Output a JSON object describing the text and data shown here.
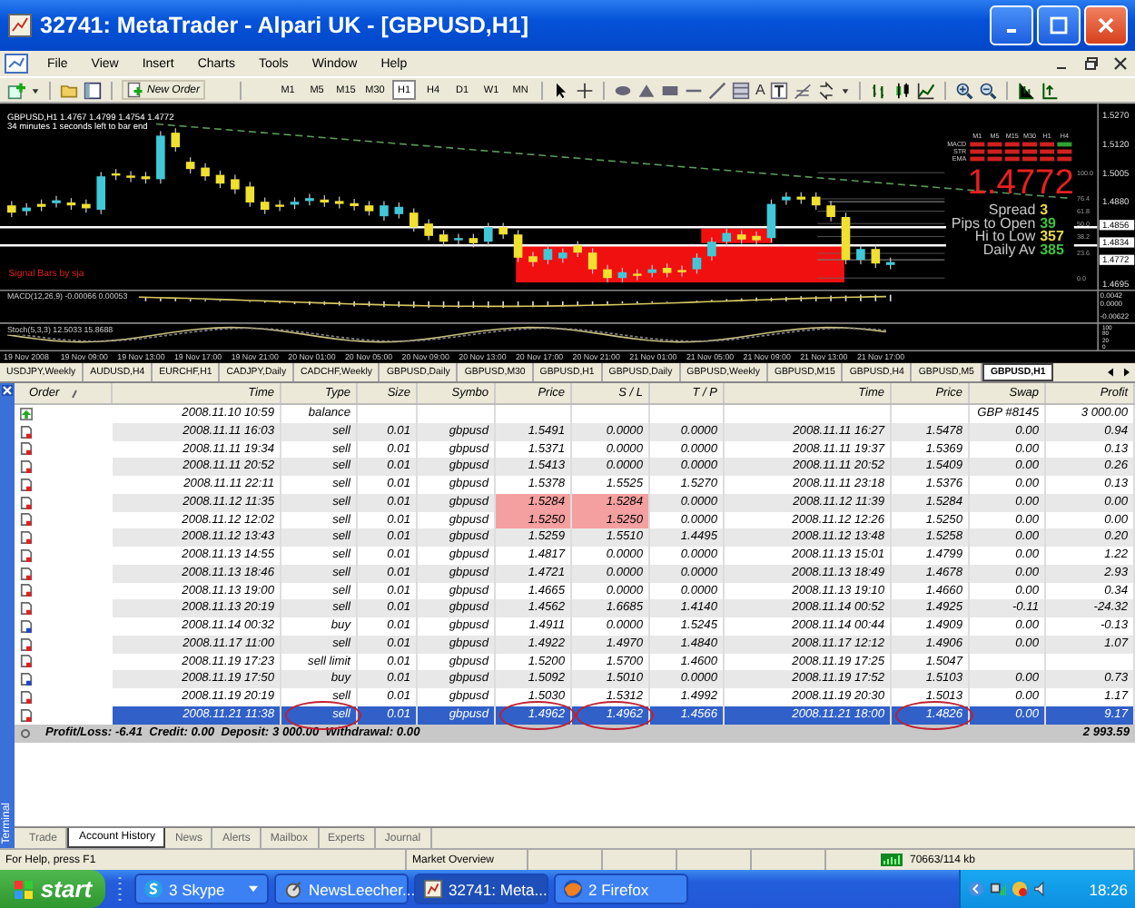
{
  "window": {
    "title": "32741: MetaTrader - Alpari UK - [GBPUSD,H1]"
  },
  "menu": [
    "File",
    "View",
    "Insert",
    "Charts",
    "Tools",
    "Window",
    "Help"
  ],
  "toolbar": {
    "new_order": "New Order",
    "text_tool": "A",
    "timeframes": [
      {
        "label": "M1",
        "selected": false
      },
      {
        "label": "M5",
        "selected": false
      },
      {
        "label": "M15",
        "selected": false
      },
      {
        "label": "M30",
        "selected": false
      },
      {
        "label": "H1",
        "selected": true
      },
      {
        "label": "H4",
        "selected": false
      },
      {
        "label": "D1",
        "selected": false
      },
      {
        "label": "W1",
        "selected": false
      },
      {
        "label": "MN",
        "selected": false
      }
    ]
  },
  "chart": {
    "header": "GBPUSD,H1  1.4767 1.4799 1.4754 1.4772",
    "timer": "34 minutes 1 seconds left to bar end",
    "signal_label": "Signal Bars by sja",
    "price": "1.4772",
    "stats": [
      {
        "label": "Spread",
        "value": "3",
        "color": "#e8d84a"
      },
      {
        "label": "Pips to Open",
        "value": "39",
        "color": "#40c040"
      },
      {
        "label": "Hi to Low",
        "value": "357",
        "color": "#e8d84a"
      },
      {
        "label": "Daily Av",
        "value": "385",
        "color": "#40c040"
      }
    ],
    "signal_grid": {
      "columns": [
        "M1",
        "M5",
        "M15",
        "M30",
        "H1",
        "H4"
      ],
      "rows": [
        {
          "label": "MACD",
          "cells": [
            {
              "color": "#d02020"
            },
            {
              "color": "#d02020"
            },
            {
              "color": "#d02020"
            },
            {
              "color": "#d02020"
            },
            {
              "color": "#d02020"
            },
            {
              "color": "#30a030"
            }
          ]
        },
        {
          "label": "STR",
          "cells": [
            {
              "color": "#d02020"
            },
            {
              "color": "#d02020"
            },
            {
              "color": "#d02020"
            },
            {
              "color": "#d02020"
            },
            {
              "color": "#d02020"
            },
            {
              "color": "#d02020"
            }
          ]
        },
        {
          "label": "EMA",
          "cells": [
            {
              "color": "#d02020"
            },
            {
              "color": "#d02020"
            },
            {
              "color": "#d02020"
            },
            {
              "color": "#d02020"
            },
            {
              "color": "#d02020"
            },
            {
              "color": "#d02020"
            }
          ]
        }
      ]
    },
    "fib_levels": [
      "100.0",
      "76.4",
      "61.8",
      "50.0",
      "38.2",
      "23.6",
      "0.0"
    ],
    "price_axis": [
      {
        "label": "1.5270",
        "boxed": false
      },
      {
        "label": "1.5120",
        "boxed": false
      },
      {
        "label": "1.5005",
        "boxed": false
      },
      {
        "label": "1.4880",
        "boxed": false
      },
      {
        "label": "1.4856",
        "boxed": true
      },
      {
        "label": "1.4834",
        "boxed": true
      },
      {
        "label": "1.4772",
        "boxed": true
      },
      {
        "label": "1.4695",
        "boxed": false
      }
    ],
    "macd": {
      "label": "MACD(12,26,9) -0.00066 0.00053",
      "axis": [
        "0.0042",
        "0.0000",
        "-0.00622"
      ]
    },
    "stoch": {
      "label": "Stoch(5,3,3) 12.5033 15.8688",
      "axis": [
        "100",
        "80",
        "20",
        "0"
      ]
    },
    "time_axis": [
      "19 Nov 2008",
      "19 Nov 09:00",
      "19 Nov 13:00",
      "19 Nov 17:00",
      "19 Nov 21:00",
      "20 Nov 01:00",
      "20 Nov 05:00",
      "20 Nov 09:00",
      "20 Nov 13:00",
      "20 Nov 17:00",
      "20 Nov 21:00",
      "21 Nov 01:00",
      "21 Nov 05:00",
      "21 Nov 09:00",
      "21 Nov 13:00",
      "21 Nov 17:00"
    ]
  },
  "chart_tabs": [
    {
      "label": "USDJPY,Weekly",
      "selected": false
    },
    {
      "label": "AUDUSD,H4",
      "selected": false
    },
    {
      "label": "EURCHF,H1",
      "selected": false
    },
    {
      "label": "CADJPY,Daily",
      "selected": false
    },
    {
      "label": "CADCHF,Weekly",
      "selected": false
    },
    {
      "label": "GBPUSD,Daily",
      "selected": false
    },
    {
      "label": "GBPUSD,M30",
      "selected": false
    },
    {
      "label": "GBPUSD,H1",
      "selected": false
    },
    {
      "label": "GBPUSD,Daily",
      "selected": false
    },
    {
      "label": "GBPUSD,Weekly",
      "selected": false
    },
    {
      "label": "GBPUSD,M15",
      "selected": false
    },
    {
      "label": "GBPUSD,H4",
      "selected": false
    },
    {
      "label": "GBPUSD,M5",
      "selected": false
    },
    {
      "label": "GBPUSD,H1",
      "selected": true
    }
  ],
  "terminal": {
    "side_label": "Terminal",
    "columns": [
      "Order",
      "Time",
      "Type",
      "Size",
      "Symbo",
      "Price",
      "S / L",
      "T / P",
      "Time",
      "Price",
      "Swap",
      "Profit"
    ],
    "rows": [
      {
        "kind": "balance",
        "selected": false,
        "cells": [
          "",
          "2008.11.10 10:59",
          "balance",
          null,
          null,
          null,
          null,
          null,
          null,
          null,
          "GBP #8145",
          "3 000.00"
        ]
      },
      {
        "kind": "sell",
        "selected": false,
        "stop_hit": false,
        "cells": [
          "",
          "2008.11.11 16:03",
          "sell",
          "0.01",
          "gbpusd",
          "1.5491",
          "0.0000",
          "0.0000",
          "2008.11.11 16:27",
          "1.5478",
          "0.00",
          "0.94"
        ]
      },
      {
        "kind": "sell",
        "selected": false,
        "stop_hit": false,
        "cells": [
          "",
          "2008.11.11 19:34",
          "sell",
          "0.01",
          "gbpusd",
          "1.5371",
          "0.0000",
          "0.0000",
          "2008.11.11 19:37",
          "1.5369",
          "0.00",
          "0.13"
        ]
      },
      {
        "kind": "sell",
        "selected": false,
        "stop_hit": false,
        "cells": [
          "",
          "2008.11.11 20:52",
          "sell",
          "0.01",
          "gbpusd",
          "1.5413",
          "0.0000",
          "0.0000",
          "2008.11.11 20:52",
          "1.5409",
          "0.00",
          "0.26"
        ]
      },
      {
        "kind": "sell",
        "selected": false,
        "stop_hit": false,
        "cells": [
          "",
          "2008.11.11 22:11",
          "sell",
          "0.01",
          "gbpusd",
          "1.5378",
          "1.5525",
          "1.5270",
          "2008.11.11 23:18",
          "1.5376",
          "0.00",
          "0.13"
        ]
      },
      {
        "kind": "sell",
        "selected": false,
        "stop_hit": true,
        "cells": [
          "",
          "2008.11.12 11:35",
          "sell",
          "0.01",
          "gbpusd",
          "1.5284",
          "1.5284",
          "0.0000",
          "2008.11.12 11:39",
          "1.5284",
          "0.00",
          "0.00"
        ]
      },
      {
        "kind": "sell",
        "selected": false,
        "stop_hit": true,
        "cells": [
          "",
          "2008.11.12 12:02",
          "sell",
          "0.01",
          "gbpusd",
          "1.5250",
          "1.5250",
          "0.0000",
          "2008.11.12 12:26",
          "1.5250",
          "0.00",
          "0.00"
        ]
      },
      {
        "kind": "sell",
        "selected": false,
        "stop_hit": false,
        "cells": [
          "",
          "2008.11.12 13:43",
          "sell",
          "0.01",
          "gbpusd",
          "1.5259",
          "1.5510",
          "1.4495",
          "2008.11.12 13:48",
          "1.5258",
          "0.00",
          "0.20"
        ]
      },
      {
        "kind": "sell",
        "selected": false,
        "stop_hit": false,
        "cells": [
          "",
          "2008.11.13 14:55",
          "sell",
          "0.01",
          "gbpusd",
          "1.4817",
          "0.0000",
          "0.0000",
          "2008.11.13 15:01",
          "1.4799",
          "0.00",
          "1.22"
        ]
      },
      {
        "kind": "sell",
        "selected": false,
        "stop_hit": false,
        "cells": [
          "",
          "2008.11.13 18:46",
          "sell",
          "0.01",
          "gbpusd",
          "1.4721",
          "0.0000",
          "0.0000",
          "2008.11.13 18:49",
          "1.4678",
          "0.00",
          "2.93"
        ]
      },
      {
        "kind": "sell",
        "selected": false,
        "stop_hit": false,
        "cells": [
          "",
          "2008.11.13 19:00",
          "sell",
          "0.01",
          "gbpusd",
          "1.4665",
          "0.0000",
          "0.0000",
          "2008.11.13 19:10",
          "1.4660",
          "0.00",
          "0.34"
        ]
      },
      {
        "kind": "sell",
        "selected": false,
        "stop_hit": false,
        "cells": [
          "",
          "2008.11.13 20:19",
          "sell",
          "0.01",
          "gbpusd",
          "1.4562",
          "1.6685",
          "1.4140",
          "2008.11.14 00:52",
          "1.4925",
          "-0.11",
          "-24.32"
        ]
      },
      {
        "kind": "buy",
        "selected": false,
        "stop_hit": false,
        "cells": [
          "",
          "2008.11.14 00:32",
          "buy",
          "0.01",
          "gbpusd",
          "1.4911",
          "0.0000",
          "1.5245",
          "2008.11.14 00:44",
          "1.4909",
          "0.00",
          "-0.13"
        ]
      },
      {
        "kind": "sell",
        "selected": false,
        "stop_hit": false,
        "cells": [
          "",
          "2008.11.17 11:00",
          "sell",
          "0.01",
          "gbpusd",
          "1.4922",
          "1.4970",
          "1.4840",
          "2008.11.17 12:12",
          "1.4906",
          "0.00",
          "1.07"
        ]
      },
      {
        "kind": "sell",
        "selected": false,
        "stop_hit": false,
        "cells": [
          "",
          "2008.11.19 17:23",
          "sell limit",
          "0.01",
          "gbpusd",
          "1.5200",
          "1.5700",
          "1.4600",
          "2008.11.19 17:25",
          "1.5047",
          null,
          null
        ]
      },
      {
        "kind": "buy",
        "selected": false,
        "stop_hit": false,
        "cells": [
          "",
          "2008.11.19 17:50",
          "buy",
          "0.01",
          "gbpusd",
          "1.5092",
          "1.5010",
          "0.0000",
          "2008.11.19 17:52",
          "1.5103",
          "0.00",
          "0.73"
        ]
      },
      {
        "kind": "sell",
        "selected": false,
        "stop_hit": false,
        "cells": [
          "",
          "2008.11.19 20:19",
          "sell",
          "0.01",
          "gbpusd",
          "1.5030",
          "1.5312",
          "1.4992",
          "2008.11.19 20:30",
          "1.5013",
          "0.00",
          "1.17"
        ]
      },
      {
        "kind": "sell",
        "selected": true,
        "stop_hit": false,
        "cells": [
          "",
          "2008.11.21 11:38",
          "sell",
          "0.01",
          "gbpusd",
          "1.4962",
          "1.4962",
          "1.4566",
          "2008.11.21 18:00",
          "1.4826",
          "0.00",
          "9.17"
        ]
      }
    ],
    "summary": "Profit/Loss: -6.41  Credit: 0.00  Deposit: 3 000.00  Withdrawal: 0.00",
    "total": "2 993.59",
    "tabs": [
      {
        "label": "Trade",
        "selected": false
      },
      {
        "label": "Account History",
        "selected": true
      },
      {
        "label": "News",
        "selected": false
      },
      {
        "label": "Alerts",
        "selected": false
      },
      {
        "label": "Mailbox",
        "selected": false
      },
      {
        "label": "Experts",
        "selected": false
      },
      {
        "label": "Journal",
        "selected": false
      }
    ]
  },
  "status_bar": {
    "help": "For Help, press F1",
    "panel": "Market Overview",
    "traffic": "70663/114 kb"
  },
  "taskbar": {
    "start": "start",
    "tasks": [
      {
        "label": "3 Skype",
        "kind": "skype",
        "selected": false
      },
      {
        "label": "NewsLeecher...",
        "kind": "satellite",
        "selected": false
      },
      {
        "label": "32741: Meta...",
        "kind": "chart",
        "selected": true
      },
      {
        "label": "2 Firefox",
        "kind": "globe",
        "selected": false
      }
    ],
    "clock": "18:26"
  }
}
